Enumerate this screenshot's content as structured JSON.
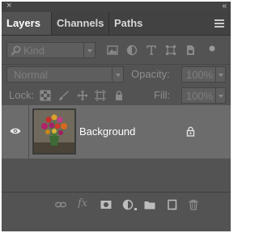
{
  "window": {
    "close_glyph": "×",
    "collapse_glyph": "«"
  },
  "tabs": [
    {
      "label": "Layers",
      "active": true
    },
    {
      "label": "Channels",
      "active": false
    },
    {
      "label": "Paths",
      "active": false
    }
  ],
  "panel_menu_icon": "hamburger-icon",
  "filter": {
    "kind_label": "Kind",
    "search_icon": "search-icon",
    "filter_icons": [
      "image-filter-icon",
      "adjustment-filter-icon",
      "type-filter-icon",
      "shape-filter-icon",
      "smart-object-filter-icon"
    ],
    "toggle_icon": "filter-toggle-dot-icon"
  },
  "blend": {
    "mode": "Normal",
    "opacity_label": "Opacity:",
    "opacity_value": "100%"
  },
  "lock": {
    "label": "Lock:",
    "icons": [
      "lock-transparent-pixels-icon",
      "lock-image-pixels-icon",
      "lock-position-icon",
      "lock-artboard-icon",
      "lock-all-icon"
    ],
    "fill_label": "Fill:",
    "fill_value": "100%"
  },
  "layers": [
    {
      "name": "Background",
      "visible": true,
      "locked": true,
      "thumbnail": "tulips-bouquet-thumbnail"
    }
  ],
  "footer_icons": [
    "link-layers-icon",
    "fx-icon",
    "add-mask-icon",
    "adjustment-layer-icon",
    "new-group-icon",
    "new-layer-icon",
    "delete-layer-icon"
  ],
  "colors": {
    "panel_bg": "#535353",
    "tab_bar_bg": "#424242",
    "selected_layer_bg": "#6c6c6c",
    "text_active": "#ffffff",
    "text_dim": "#8d8d8d"
  }
}
